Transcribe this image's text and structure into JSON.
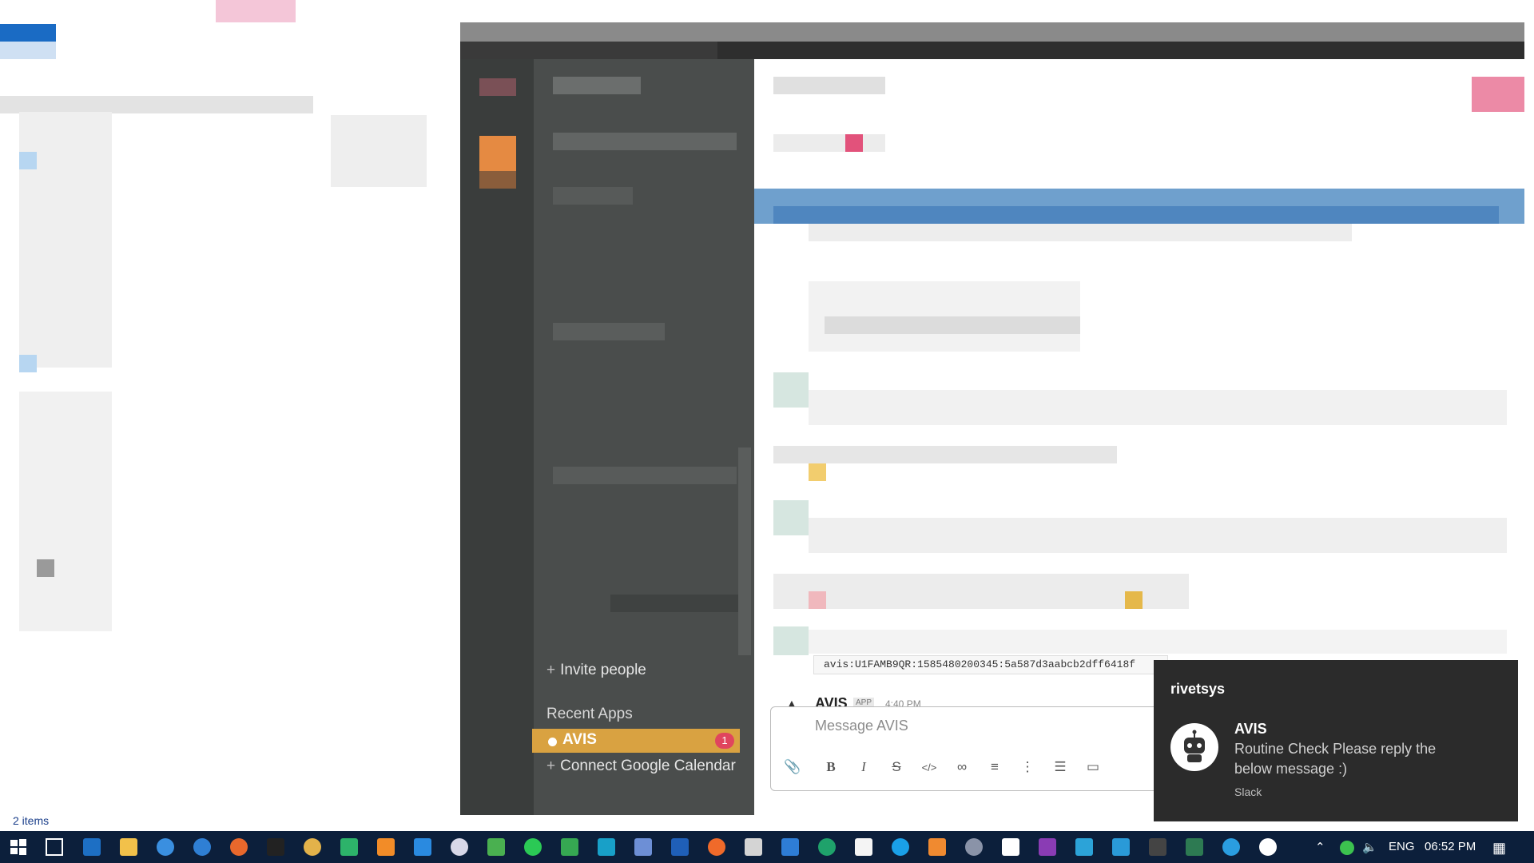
{
  "explorer": {
    "status_items": "2 items"
  },
  "slack": {
    "sidebar": {
      "invite_label": "Invite people",
      "recent_apps_heading": "Recent Apps",
      "apps": [
        {
          "name": "AVIS",
          "badge": "1",
          "active": true
        }
      ],
      "connect_label": "Connect Google Calendar"
    },
    "messages": {
      "code_line": "avis:U1FAMB9QR:1585480200345:5a587d3aabcb2dff6418f",
      "author": "AVIS",
      "app_tag": "APP",
      "time": "4:40 PM"
    },
    "composer": {
      "placeholder": "Message AVIS"
    }
  },
  "notification": {
    "app": "rivetsys",
    "title": "AVIS",
    "body": "Routine Check Please reply the below message :)",
    "source": "Slack"
  },
  "taskbar": {
    "language": "ENG",
    "clock": "06:52 PM"
  },
  "colors": {
    "accent": "#d9a241",
    "badge": "#e0455e",
    "sidebar": "#4a4d4c",
    "taskbar": "#0c1f3b"
  }
}
